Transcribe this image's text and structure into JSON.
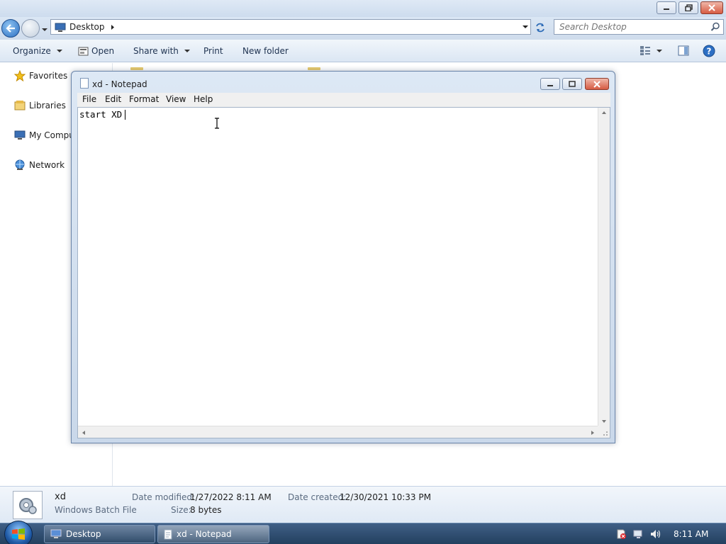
{
  "explorer": {
    "address": {
      "location": "Desktop"
    },
    "search": {
      "placeholder": "Search Desktop"
    },
    "toolbar": {
      "organize": "Organize",
      "open": "Open",
      "share_with": "Share with",
      "print": "Print",
      "new_folder": "New folder"
    },
    "nav": {
      "favorites": "Favorites",
      "libraries": "Libraries",
      "computer": "My Compu",
      "network": "Network"
    },
    "details": {
      "name": "xd",
      "type": "Windows Batch File",
      "modified_label": "Date modified:",
      "modified_value": "1/27/2022 8:11 AM",
      "size_label": "Size:",
      "size_value": "8 bytes",
      "created_label": "Date created:",
      "created_value": "12/30/2021 10:33 PM"
    }
  },
  "notepad": {
    "title": "xd - Notepad",
    "menu": [
      "File",
      "Edit",
      "Format",
      "View",
      "Help"
    ],
    "content": "start XD"
  },
  "taskbar": {
    "tasks": [
      {
        "label": "Desktop"
      },
      {
        "label": "xd - Notepad"
      }
    ],
    "clock": "8:11 AM"
  },
  "colors": {
    "accent": "#2b6fc2",
    "taskbar": "#2d4c70",
    "close_button": "#d65b42"
  }
}
